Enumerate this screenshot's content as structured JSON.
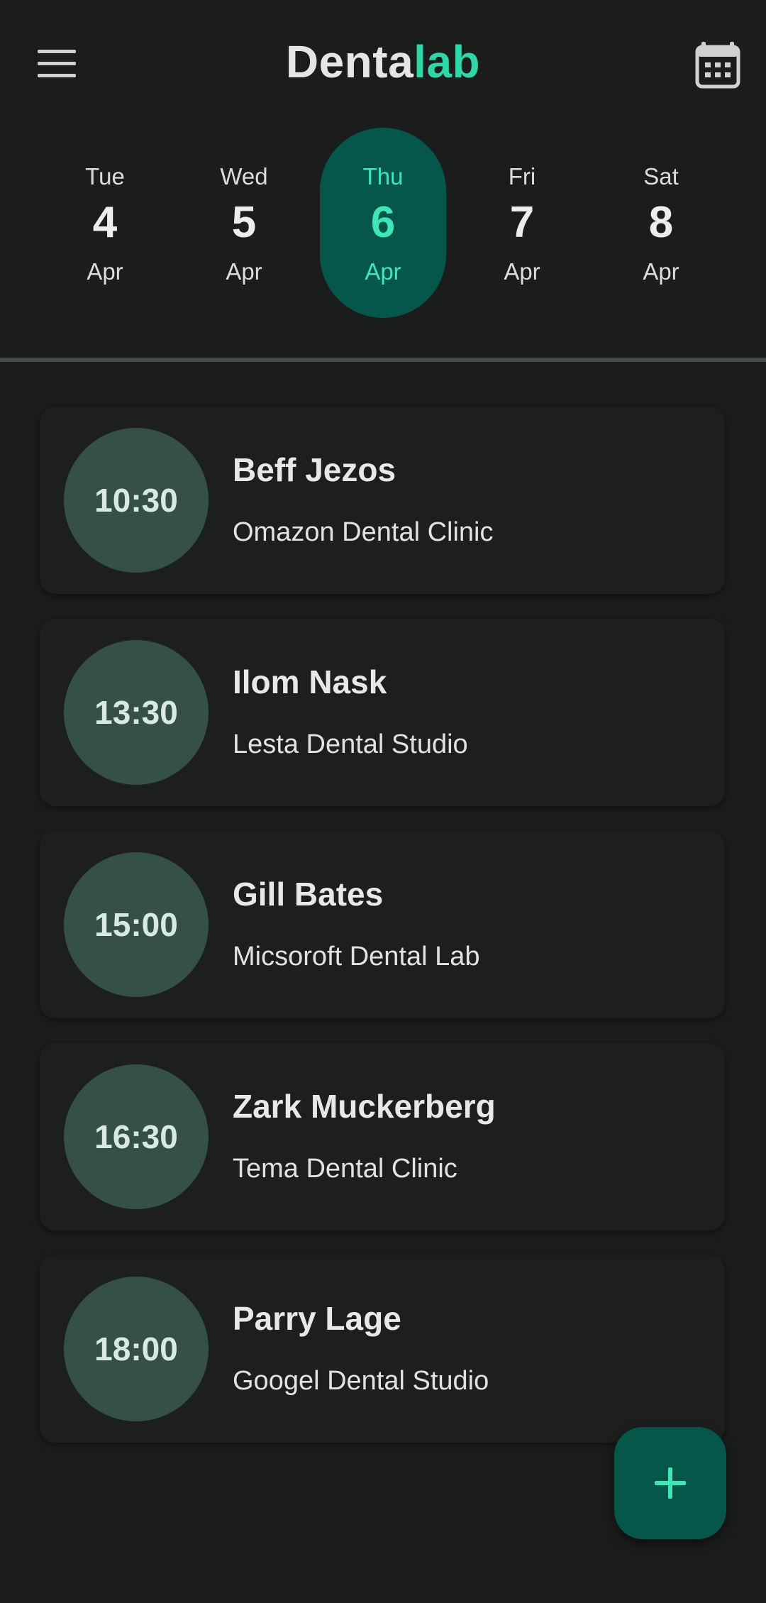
{
  "app": {
    "title_part1": "Denta",
    "title_part2": "lab",
    "accent_color": "#2fd6a8",
    "selected_day_bg": "#04574a"
  },
  "header": {
    "menu_icon": "hamburger-menu-icon",
    "calendar_icon": "calendar-icon"
  },
  "days": [
    {
      "dow": "Tue",
      "num": "4",
      "mon": "Apr",
      "selected": false
    },
    {
      "dow": "Wed",
      "num": "5",
      "mon": "Apr",
      "selected": false
    },
    {
      "dow": "Thu",
      "num": "6",
      "mon": "Apr",
      "selected": true
    },
    {
      "dow": "Fri",
      "num": "7",
      "mon": "Apr",
      "selected": false
    },
    {
      "dow": "Sat",
      "num": "8",
      "mon": "Apr",
      "selected": false
    }
  ],
  "appointments": [
    {
      "time": "10:30",
      "name": "Beff Jezos",
      "clinic": "Omazon Dental Clinic"
    },
    {
      "time": "13:30",
      "name": "Ilom Nask",
      "clinic": "Lesta Dental Studio"
    },
    {
      "time": "15:00",
      "name": "Gill Bates",
      "clinic": "Micsoroft Dental Lab"
    },
    {
      "time": "16:30",
      "name": "Zark Muckerberg",
      "clinic": "Tema Dental Clinic"
    },
    {
      "time": "18:00",
      "name": "Parry Lage",
      "clinic": "Googel Dental Studio"
    }
  ],
  "fab": {
    "icon": "plus-icon"
  }
}
